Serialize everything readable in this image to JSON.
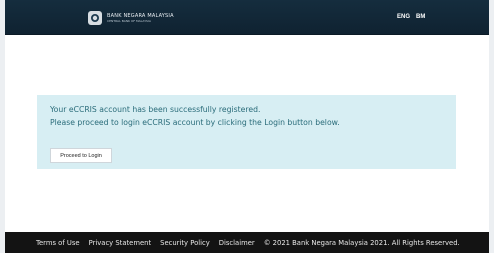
{
  "header": {
    "logo_text": "BANK NEGARA MALAYSIA",
    "logo_subtext": "CENTRAL BANK OF MALAYSIA",
    "lang_eng": "ENG",
    "lang_bm": "BM"
  },
  "main": {
    "message_line1": "Your eCCRIS account has been successfully registered.",
    "message_line2": "Please proceed to login eCCRIS account by clicking the Login button below.",
    "proceed_button": "Proceed to Login"
  },
  "footer": {
    "terms": "Terms of Use",
    "privacy": "Privacy Statement",
    "security": "Security Policy",
    "disclaimer": "Disclaimer",
    "copyright": "© 2021 Bank Negara Malaysia 2021. All Rights Reserved."
  },
  "icons": {
    "logo": "bank-logo-icon"
  },
  "colors": {
    "topbar": "#152d3e",
    "notice_bg": "#d7eef3",
    "notice_text": "#2a6c7a",
    "footer_bg": "#131313"
  }
}
